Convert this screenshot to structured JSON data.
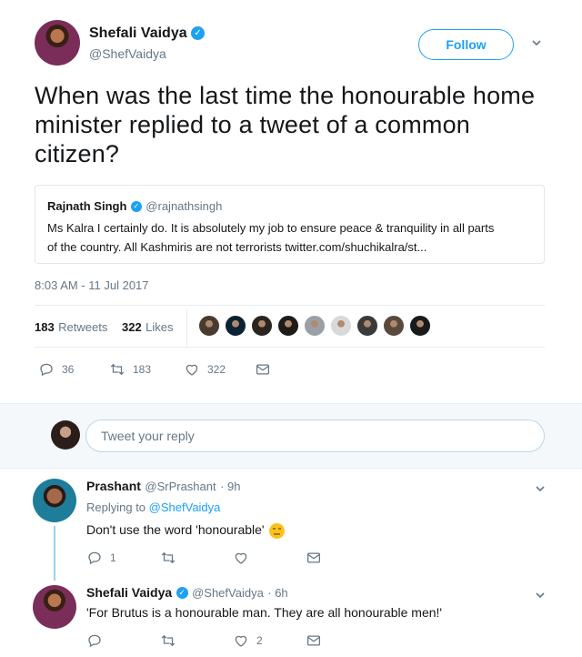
{
  "tweet": {
    "author_name": "Shefali Vaidya",
    "author_handle": "@ShefVaidya",
    "follow_label": "Follow",
    "text": "When was the last time the honourable home minister replied to a tweet of a common citizen?",
    "timestamp": "8:03 AM - 11 Jul 2017",
    "retweets_count": "183",
    "retweets_label": "Retweets",
    "likes_count": "322",
    "likes_label": "Likes",
    "actions": {
      "replies": "36",
      "retweets": "183",
      "likes": "322"
    }
  },
  "quoted": {
    "author_name": "Rajnath Singh",
    "author_handle": "@rajnathsingh",
    "text_line1": "Ms Kalra I certainly do. It is absolutely my job to ensure peace & tranquility in all parts",
    "text_line2": "of the country. All Kashmiris are not terrorists twitter.com/shuchikalra/st..."
  },
  "likers": [
    {
      "color": "#4a3b2f"
    },
    {
      "color": "#0b2233"
    },
    {
      "color": "#2b2520"
    },
    {
      "color": "#1e1b19"
    },
    {
      "color": "#9aa0a6"
    },
    {
      "color": "#d9d9d9"
    },
    {
      "color": "#3a3a3a"
    },
    {
      "color": "#5a4a3e"
    },
    {
      "color": "#1a1a1a"
    }
  ],
  "reply_box": {
    "placeholder": "Tweet your reply"
  },
  "replies": [
    {
      "name": "Prashant",
      "handle": "@SrPrashant",
      "time": "· 9h",
      "replying_prefix": "Replying to",
      "replying_to": "@ShefVaidya",
      "text": "Don't use the word 'honourable'",
      "reply_count": "1",
      "retweet_count": "",
      "like_count": ""
    },
    {
      "name": "Shefali Vaidya",
      "handle": "@ShefVaidya",
      "time": "· 6h",
      "text": "'For Brutus is a honourable man. They are all honourable men!'",
      "reply_count": "",
      "retweet_count": "",
      "like_count": "2"
    }
  ],
  "colors": {
    "accent": "#1da1f2",
    "muted": "#657786",
    "border": "#e6ecf0"
  }
}
